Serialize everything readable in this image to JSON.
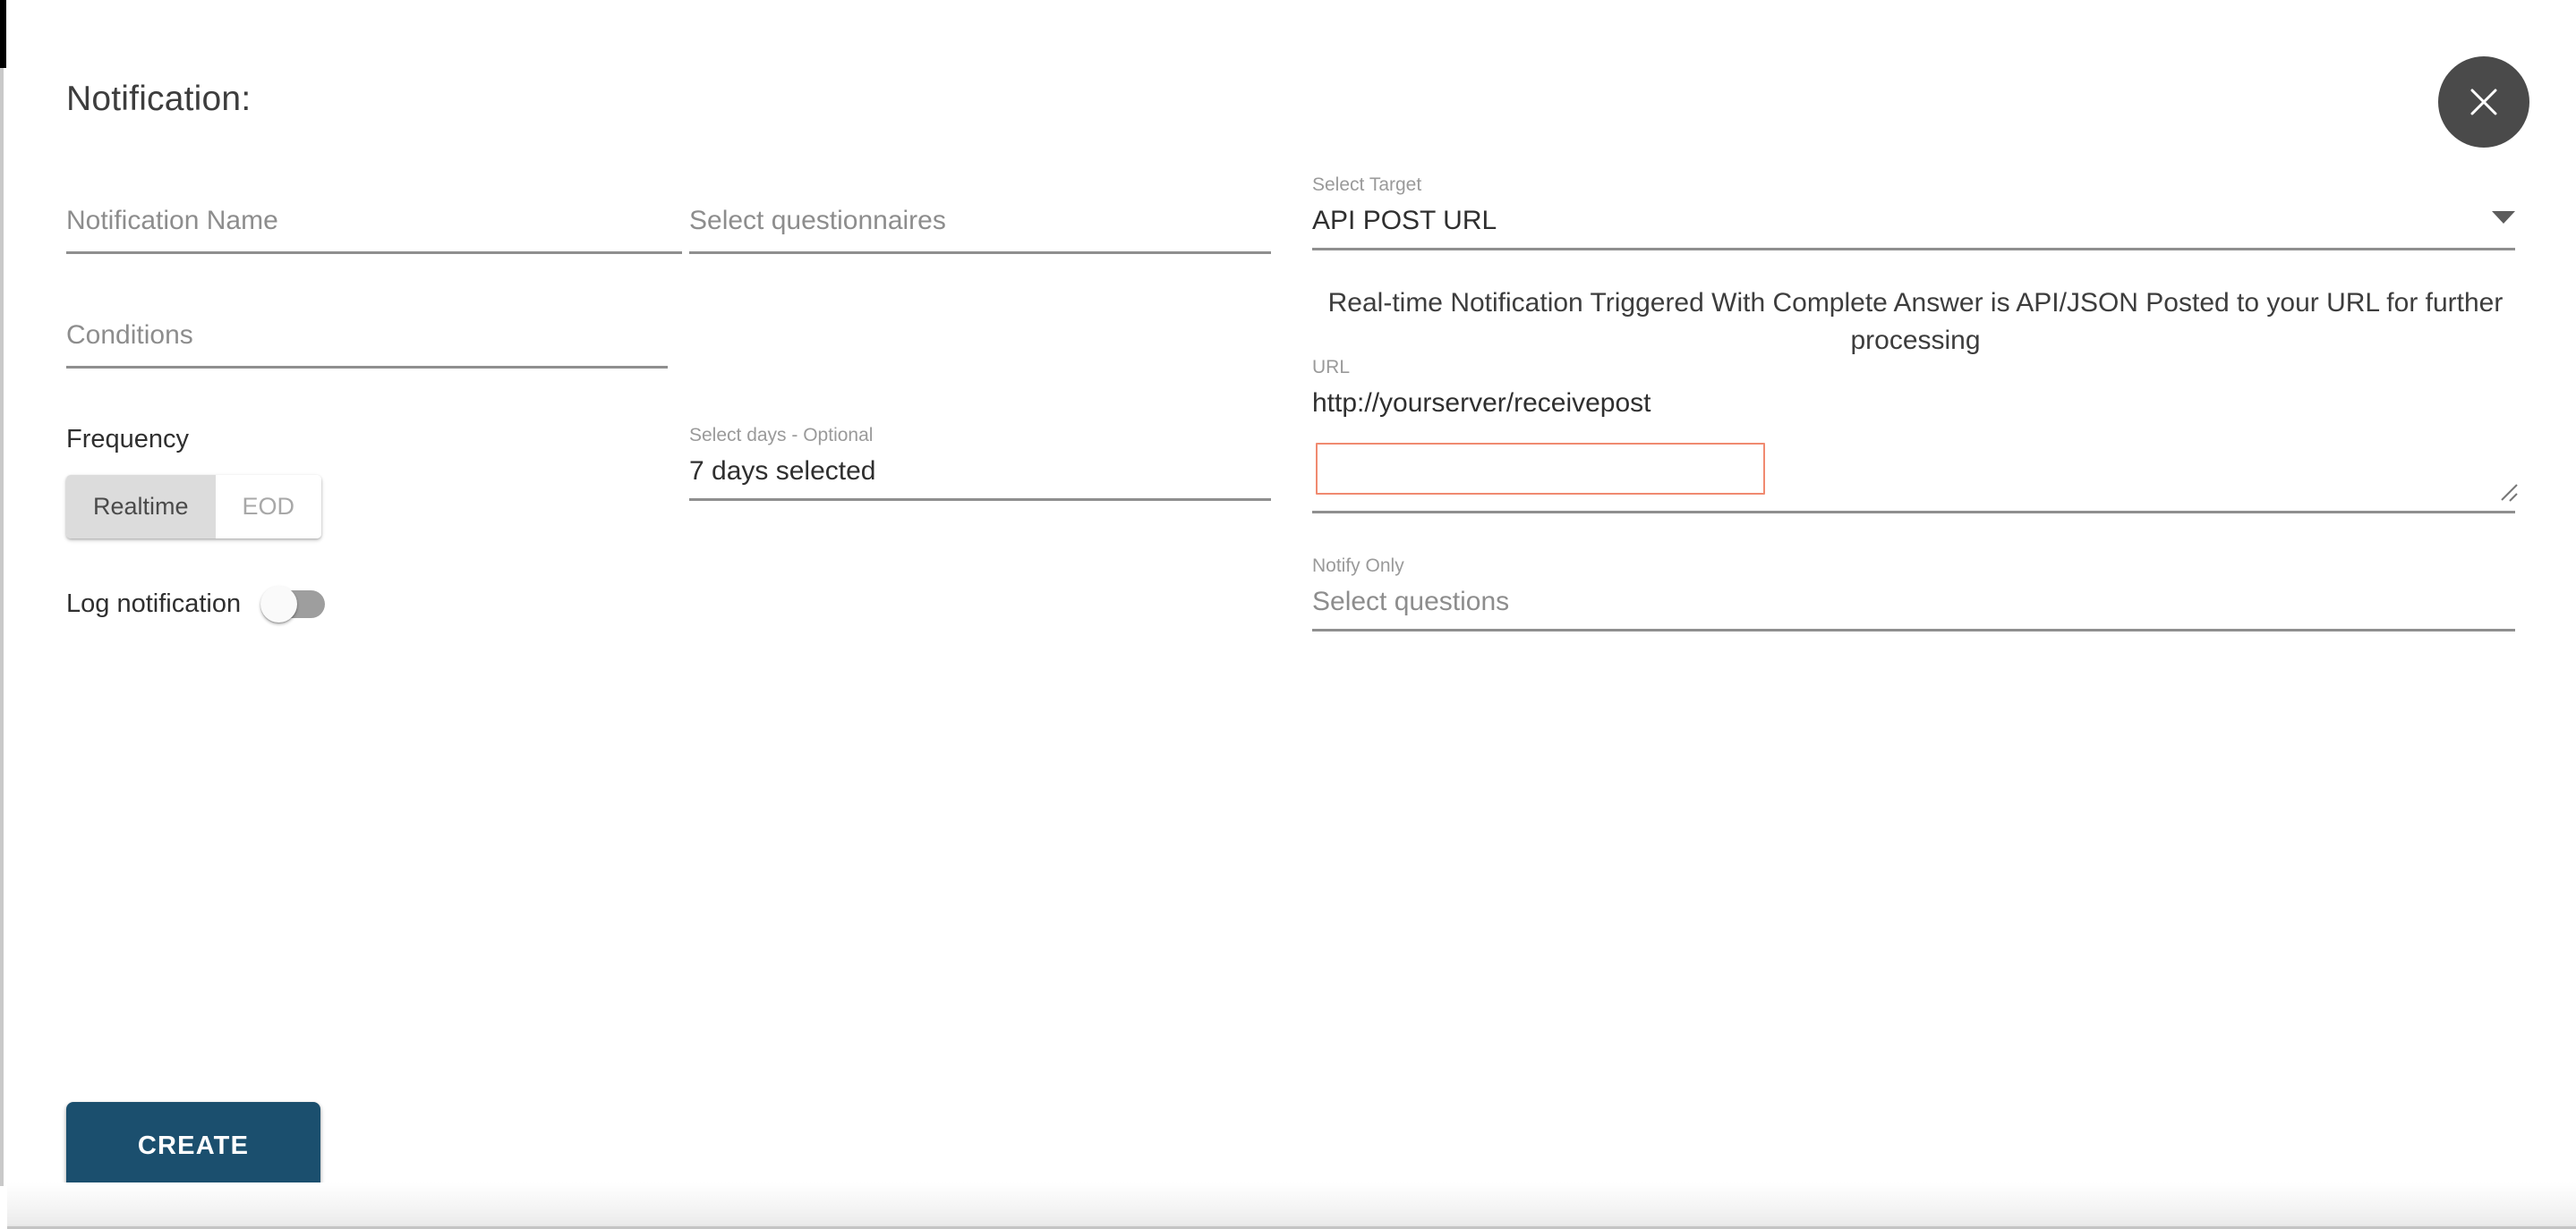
{
  "dialog": {
    "title": "Notification:",
    "close_label": "close"
  },
  "left_column": {
    "notification_name": {
      "placeholder": "Notification Name",
      "value": ""
    },
    "conditions": {
      "placeholder": "Conditions",
      "value": ""
    },
    "frequency": {
      "label": "Frequency",
      "options": [
        {
          "label": "Realtime",
          "selected": true
        },
        {
          "label": "EOD",
          "selected": false
        }
      ]
    },
    "log_notification": {
      "label": "Log notification",
      "state": "off"
    }
  },
  "middle_column": {
    "questionnaires": {
      "placeholder": "Select questionnaires",
      "value": ""
    },
    "days": {
      "caption": "Select days - Optional",
      "value": "7 days selected"
    }
  },
  "right_column": {
    "target": {
      "caption": "Select Target",
      "value": "API POST URL"
    },
    "description": "Real-time Notification Triggered With Complete Answer is API/JSON Posted to your URL for further processing",
    "url": {
      "caption": "URL",
      "value": "http://yourserver/receivepost",
      "textarea_value": ""
    },
    "notify_only": {
      "caption": "Notify Only",
      "placeholder": "Select questions",
      "value": ""
    }
  },
  "footer": {
    "create_label": "CREATE"
  },
  "colors": {
    "primary_button": "#1b4f6e",
    "close_button": "#4a4a4a",
    "underline": "#8f8f8f",
    "error_border": "#f08a70",
    "toggle_selected_bg": "#dcdcdc",
    "switch_track": "#9e9e9e"
  }
}
